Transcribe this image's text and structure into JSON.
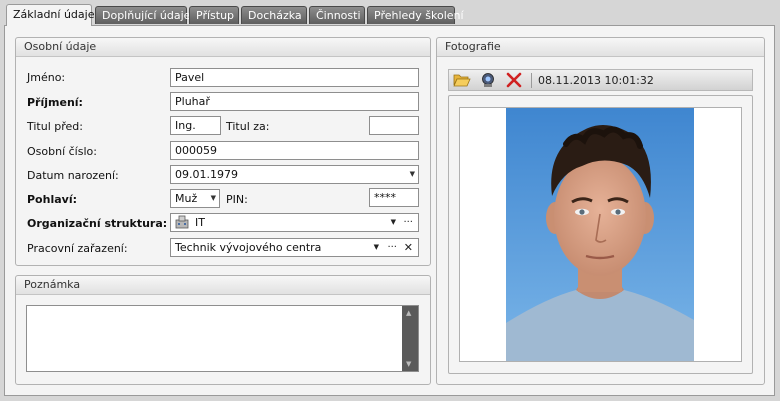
{
  "tabs": [
    {
      "label": "Základní údaje",
      "active": true
    },
    {
      "label": "Doplňující údaje",
      "active": false
    },
    {
      "label": "Přístup",
      "active": false
    },
    {
      "label": "Docházka",
      "active": false
    },
    {
      "label": "Činnosti",
      "active": false
    },
    {
      "label": "Přehledy školení",
      "active": false
    }
  ],
  "personal": {
    "title": "Osobní údaje",
    "first_name_label": "Jméno:",
    "first_name": "Pavel",
    "last_name_label": "Příjmení:",
    "last_name": "Pluhař",
    "title_before_label": "Titul před:",
    "title_before": "Ing.",
    "title_after_label": "Titul za:",
    "title_after": "",
    "personal_number_label": "Osobní číslo:",
    "personal_number": "000059",
    "birth_date_label": "Datum narození:",
    "birth_date": "09.01.1979",
    "gender_label": "Pohlaví:",
    "gender": "Muž",
    "pin_label": "PIN:",
    "pin": "****",
    "org_label": "Organizační struktura:",
    "org": "IT",
    "position_label": "Pracovní zařazení:",
    "position": "Technik vývojového centra"
  },
  "note": {
    "title": "Poznámka",
    "text": ""
  },
  "photo": {
    "title": "Fotografie",
    "timestamp": "08.11.2013 10:01:32"
  },
  "icons": {
    "open": "folder-open-icon",
    "webcam": "webcam-icon",
    "delete": "delete-x-icon",
    "building": "building-icon",
    "ellipsis": "ellipsis-icon",
    "clear": "clear-x-icon",
    "dropdown": "chevron-down-icon"
  },
  "colors": {
    "tab_inactive": "#6f6f6f",
    "photo_background": "#5b9bd5",
    "delete_red": "#d02020"
  }
}
